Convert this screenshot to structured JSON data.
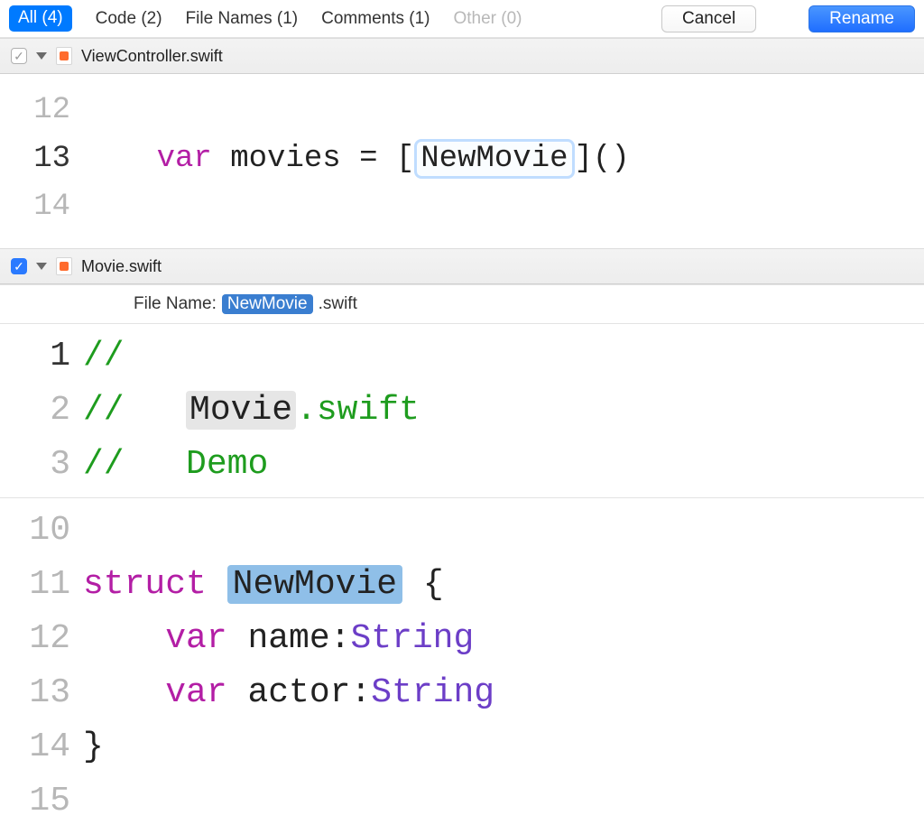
{
  "topbar": {
    "all": "All (4)",
    "code": "Code (2)",
    "filenames": "File Names (1)",
    "comments": "Comments (1)",
    "other": "Other (0)",
    "cancel": "Cancel",
    "rename": "Rename"
  },
  "file1": {
    "name": "ViewController.swift",
    "lines": {
      "l12": "12",
      "l13": "13",
      "l14": "14",
      "kw_var": "var",
      "ident": " movies = [",
      "boxed": "NewMovie",
      "tail": "]()"
    }
  },
  "file2": {
    "name": "Movie.swift",
    "filenamerow": {
      "label": "File Name: ",
      "newname": "NewMovie",
      "ext": ".swift"
    },
    "lines": {
      "l1": "1",
      "l2": "2",
      "l3": "3",
      "l10": "10",
      "l11": "11",
      "l12": "12",
      "l13": "13",
      "l14": "14",
      "l15": "15",
      "slashes": "// ",
      "comment_name_pre": "  ",
      "comment_name": "Movie",
      "comment_name_post": ".swift",
      "comment_demo": "  Demo",
      "kw_struct": "struct ",
      "structname": "NewMovie",
      "brace_open": " {",
      "kw_var": "var",
      "prop1": " name:",
      "type1": "String",
      "prop2": " actor:",
      "type2": "String",
      "brace_close": "}"
    }
  }
}
